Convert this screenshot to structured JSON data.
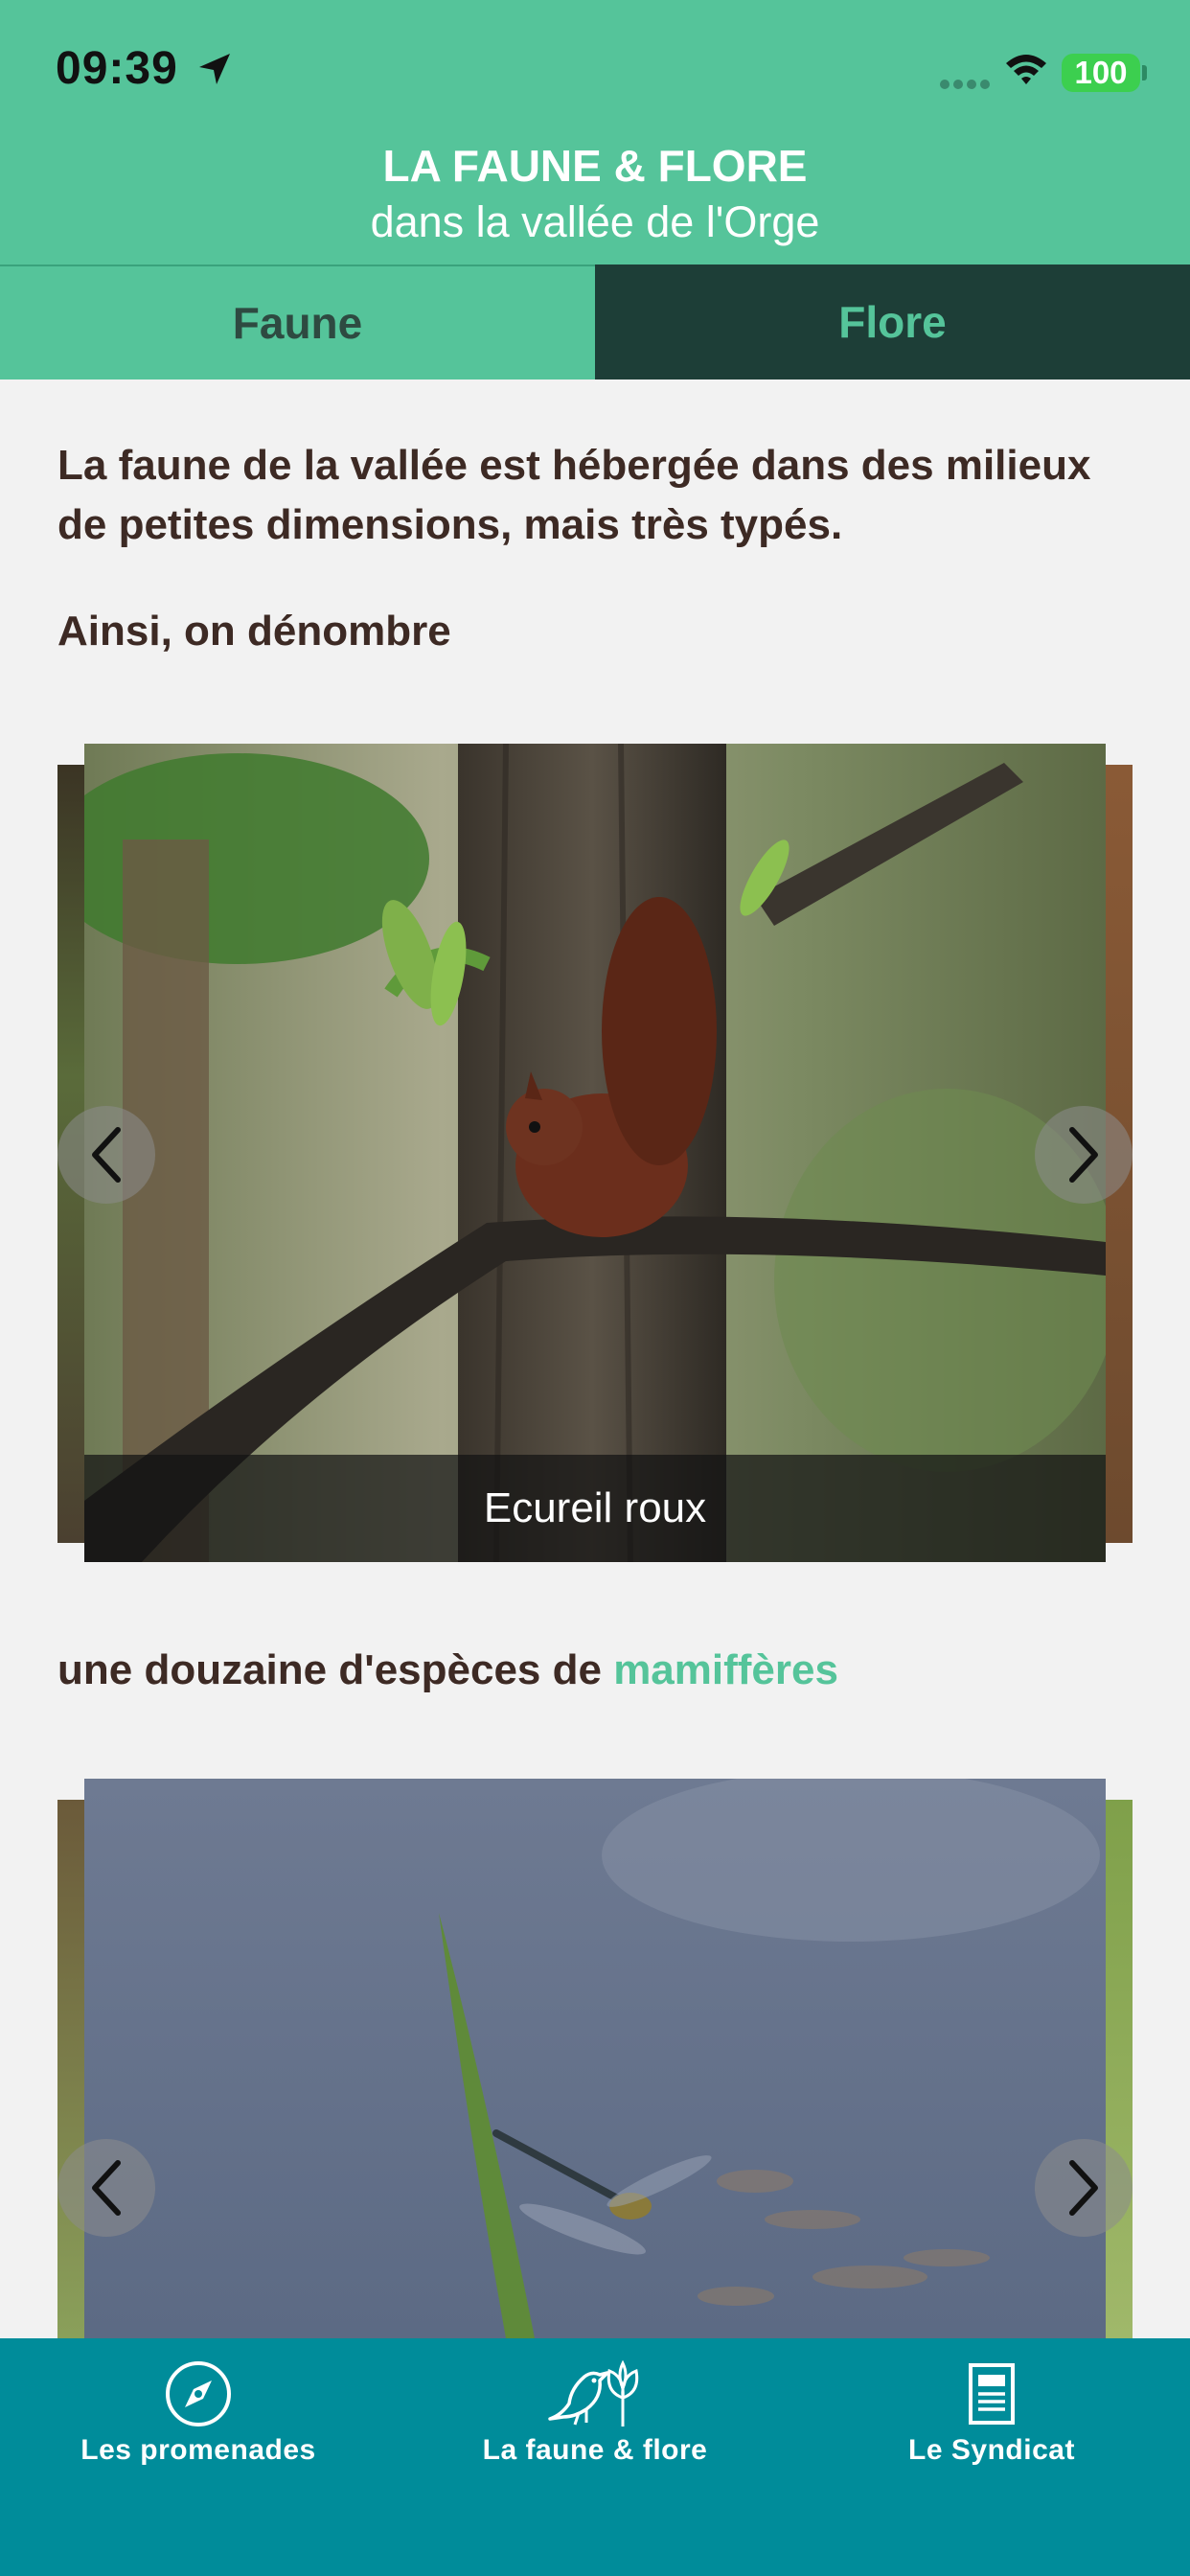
{
  "status_bar": {
    "time": "09:39",
    "battery": "100"
  },
  "header": {
    "title": "LA FAUNE & FLORE",
    "subtitle": "dans la vallée de l'Orge"
  },
  "tabs": [
    {
      "label": "Faune"
    },
    {
      "label": "Flore"
    }
  ],
  "intro": {
    "paragraph": "La faune de la vallée est hébergée dans des milieux de petites dimensions, mais très typés.",
    "lead": "Ainsi, on dénombre"
  },
  "carousel1": {
    "caption": "Ecureil roux"
  },
  "section1": {
    "prefix": "une douzaine d'espèces de ",
    "highlight": "mamiffères"
  },
  "tabbar": [
    {
      "label": "Les promenades",
      "icon": "compass-icon"
    },
    {
      "label": "La faune & flore",
      "icon": "bird-leaf-icon"
    },
    {
      "label": "Le Syndicat",
      "icon": "document-icon"
    }
  ],
  "colors": {
    "accent": "#55c49a",
    "dark_tab": "#1d3e37",
    "tabbar": "#008c9a",
    "text": "#3d2a24"
  }
}
